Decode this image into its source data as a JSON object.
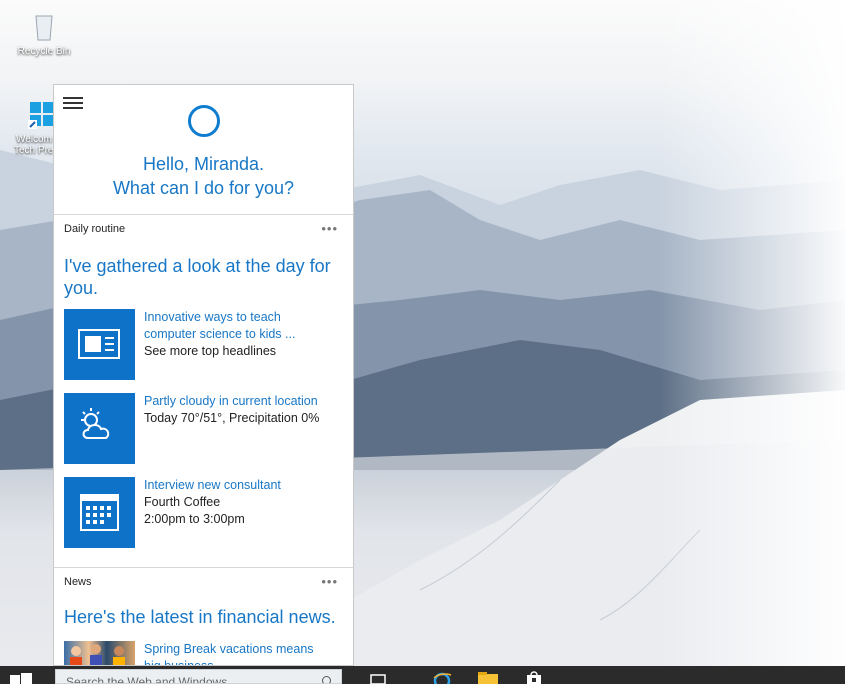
{
  "desktop": {
    "icons": [
      {
        "label": "Recycle Bin"
      },
      {
        "label_line1": "Welcom",
        "label_line2": "Tech Pre"
      }
    ]
  },
  "cortana": {
    "greeting_line1": "Hello, Miranda.",
    "greeting_line2": "What can I do for you?",
    "accent_color": "#0f72c9",
    "daily_routine": {
      "label": "Daily routine",
      "more": "•••",
      "headline": "I've gathered a look at the day for you.",
      "cards": [
        {
          "icon": "news-icon",
          "title_line1": "Innovative ways to teach",
          "title_line2": "computer science to kids ...",
          "sub1": "See more top headlines",
          "sub2": ""
        },
        {
          "icon": "weather-partly-cloudy-icon",
          "title_line1": "Partly cloudy in current location",
          "title_line2": "",
          "sub1": "Today 70°/51°, Precipitation 0%",
          "sub2": ""
        },
        {
          "icon": "calendar-icon",
          "title_line1": "Interview new consultant",
          "title_line2": "",
          "sub1": "Fourth Coffee",
          "sub2": "2:00pm to 3:00pm"
        }
      ]
    },
    "news": {
      "label": "News",
      "more": "•••",
      "headline": "Here's the latest in financial news.",
      "item_title_line1": "Spring Break vacations means",
      "item_title_line2": "big business"
    }
  },
  "taskbar": {
    "search_placeholder": "Search the Web and Windows",
    "icons": [
      "windows-start-icon",
      "search-icon",
      "task-view-icon",
      "internet-explorer-icon",
      "file-explorer-icon",
      "store-icon"
    ]
  }
}
